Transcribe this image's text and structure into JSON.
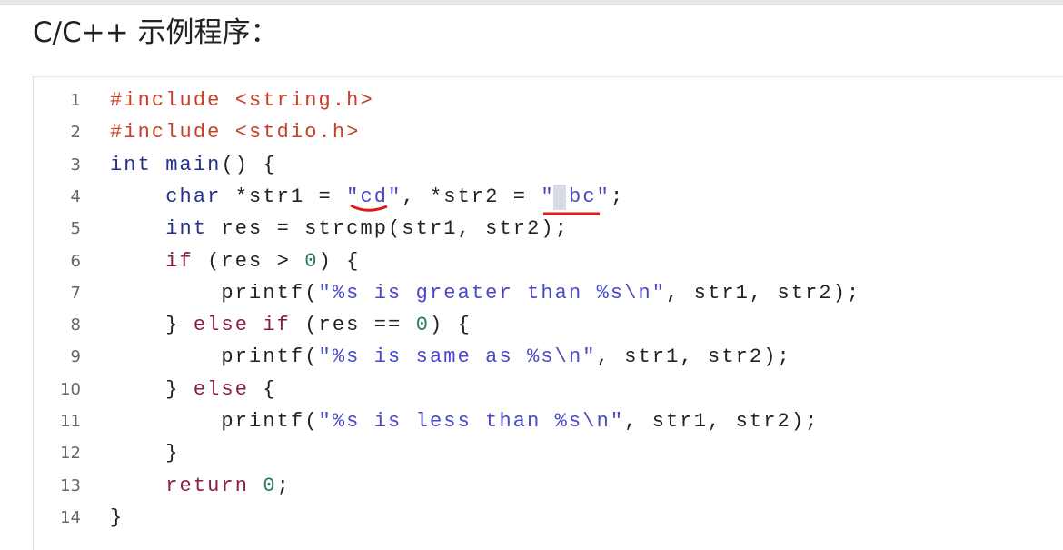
{
  "title": "C/C++ 示例程序：",
  "code_lines": [
    [
      [
        "#include <string.h>",
        "pre"
      ]
    ],
    [
      [
        "#include <stdio.h>",
        "pre"
      ]
    ],
    [
      [
        "int",
        "kw"
      ],
      [
        " ",
        "plain"
      ],
      [
        "main",
        "fn"
      ],
      [
        "() {",
        "plain"
      ]
    ],
    [
      [
        "    ",
        "plain"
      ],
      [
        "char",
        "kw"
      ],
      [
        " *str1 = ",
        "plain"
      ],
      [
        "\"cd\"",
        "str"
      ],
      [
        ", *str2 = ",
        "plain"
      ],
      [
        "\"abc\"",
        "str"
      ],
      [
        ";",
        "plain"
      ]
    ],
    [
      [
        "    ",
        "plain"
      ],
      [
        "int",
        "kw"
      ],
      [
        " res = strcmp(str1, str2);",
        "plain"
      ]
    ],
    [
      [
        "    ",
        "plain"
      ],
      [
        "if",
        "ctl"
      ],
      [
        " (res > ",
        "plain"
      ],
      [
        "0",
        "num"
      ],
      [
        ") {",
        "plain"
      ]
    ],
    [
      [
        "        printf(",
        "plain"
      ],
      [
        "\"%s is greater than %s\\n\"",
        "str"
      ],
      [
        ", str1, str2);",
        "plain"
      ]
    ],
    [
      [
        "    } ",
        "plain"
      ],
      [
        "else if",
        "ctl"
      ],
      [
        " (res == ",
        "plain"
      ],
      [
        "0",
        "num"
      ],
      [
        ") {",
        "plain"
      ]
    ],
    [
      [
        "        printf(",
        "plain"
      ],
      [
        "\"%s is same as %s\\n\"",
        "str"
      ],
      [
        ", str1, str2);",
        "plain"
      ]
    ],
    [
      [
        "    } ",
        "plain"
      ],
      [
        "else",
        "ctl"
      ],
      [
        " {",
        "plain"
      ]
    ],
    [
      [
        "        printf(",
        "plain"
      ],
      [
        "\"%s is less than %s\\n\"",
        "str"
      ],
      [
        ", str1, str2);",
        "plain"
      ]
    ],
    [
      [
        "    }",
        "plain"
      ]
    ],
    [
      [
        "    ",
        "plain"
      ],
      [
        "return",
        "ctl"
      ],
      [
        " ",
        "plain"
      ],
      [
        "0",
        "num"
      ],
      [
        ";",
        "plain"
      ]
    ],
    [
      [
        "}",
        "plain"
      ]
    ]
  ],
  "line_numbers": [
    "1",
    "2",
    "3",
    "4",
    "5",
    "6",
    "7",
    "8",
    "9",
    "10",
    "11",
    "12",
    "13",
    "14"
  ],
  "colors": {
    "annotation": "#e01818"
  }
}
